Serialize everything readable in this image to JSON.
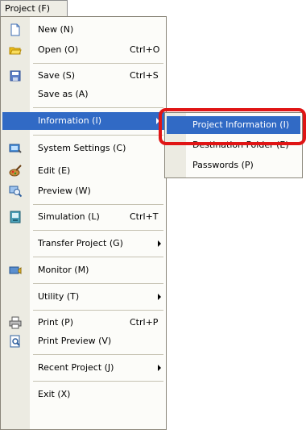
{
  "menubar": {
    "title": "Project (F)"
  },
  "menu": {
    "items": [
      {
        "label": "New (N)",
        "icon": "new-document-icon"
      },
      {
        "label": "Open (O)",
        "shortcut": "Ctrl+O",
        "icon": "open-folder-icon"
      },
      {
        "label": "Save (S)",
        "shortcut": "Ctrl+S",
        "icon": "save-disk-icon"
      },
      {
        "label": "Save as (A)"
      },
      {
        "label": "Information (I)",
        "highlighted": true
      },
      {
        "label": "System Settings (C)",
        "icon": "system-settings-icon"
      },
      {
        "label": "Edit (E)",
        "icon": "edit-palette-icon"
      },
      {
        "label": "Preview (W)",
        "icon": "preview-icon"
      },
      {
        "label": "Simulation (L)",
        "shortcut": "Ctrl+T",
        "icon": "simulation-icon"
      },
      {
        "label": "Transfer Project (G)"
      },
      {
        "label": "Monitor (M)",
        "icon": "monitor-icon"
      },
      {
        "label": "Utility (T)"
      },
      {
        "label": "Print (P)",
        "shortcut": "Ctrl+P",
        "icon": "print-icon"
      },
      {
        "label": "Print Preview (V)",
        "icon": "print-preview-icon"
      },
      {
        "label": "Recent Project (J)"
      },
      {
        "label": "Exit (X)"
      }
    ]
  },
  "submenu": {
    "items": [
      {
        "label": "Project Information (I)",
        "highlighted": true
      },
      {
        "label": "Destination Folder (E)"
      },
      {
        "label": "Passwords (P)"
      }
    ]
  },
  "colors": {
    "highlight": "#316ac5",
    "callout": "#e01515"
  }
}
